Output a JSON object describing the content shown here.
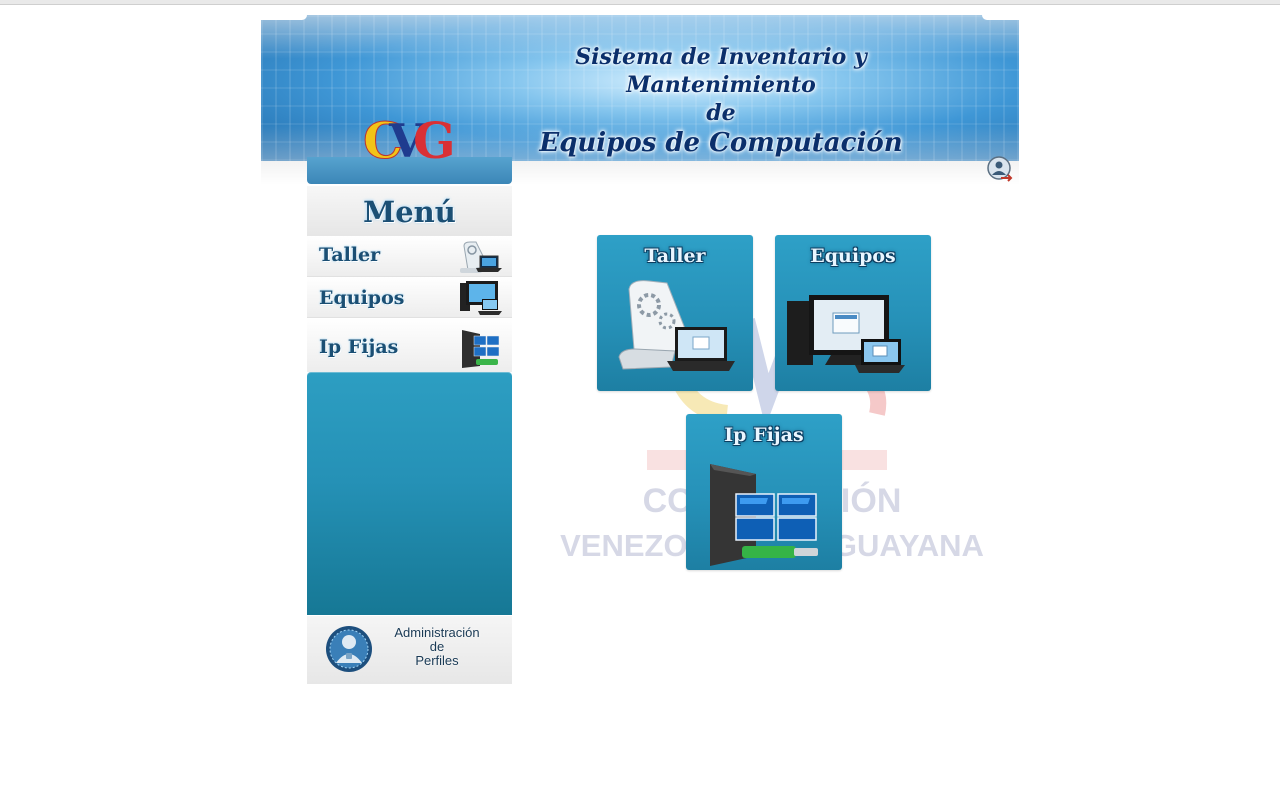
{
  "header": {
    "title_line1": "Sistema de Inventario y Mantenimiento",
    "title_line2": "de",
    "title_line3": "Equipos de Computación",
    "logo_text": "CVG",
    "exit_icon": "logout-icon"
  },
  "sidebar": {
    "menu_title": "Menú",
    "items": [
      {
        "label": "Taller",
        "icon": "workshop-icon"
      },
      {
        "label": "Equipos",
        "icon": "computers-icon"
      },
      {
        "label": "Ip Fijas",
        "icon": "network-icon"
      }
    ],
    "admin": {
      "line1": "Administración",
      "line2": "de",
      "line3": "Perfiles",
      "icon": "profile-admin-icon"
    }
  },
  "main": {
    "tiles": [
      {
        "label": "Taller",
        "icon": "workshop-icon"
      },
      {
        "label": "Equipos",
        "icon": "computers-icon"
      },
      {
        "label": "Ip Fijas",
        "icon": "network-icon"
      }
    ],
    "watermark": {
      "line1": "CORPORACIÓN",
      "line2": "VENEZOLANA DE GUAYANA"
    }
  },
  "colors": {
    "tile_blue": "#2691b8",
    "menu_text": "#1b4f74",
    "banner_blue": "#3f97d6"
  }
}
